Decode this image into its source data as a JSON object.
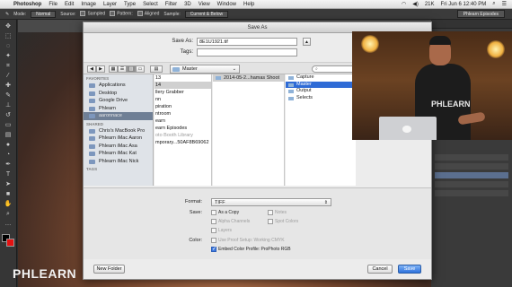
{
  "menubar": {
    "app": "Photoshop",
    "items": [
      "File",
      "Edit",
      "Image",
      "Layer",
      "Type",
      "Select",
      "Filter",
      "3D",
      "View",
      "Window",
      "Help"
    ],
    "battery": "21K",
    "clock": "Fri Jun 6 12:40 PM"
  },
  "options_bar": {
    "mode_label": "Mode:",
    "mode_value": "Normal",
    "source_label": "Source:",
    "sampled_label": "Sampled",
    "pattern_label": "Pattern:",
    "aligned_label": "Aligned",
    "sample_label": "Sample:",
    "sample_value": "Current & Below",
    "workspace": "Phlearn Episodes"
  },
  "dialog": {
    "title": "Save As",
    "save_as_label": "Save As:",
    "save_as_value": "8E1U1921.tif",
    "tags_label": "Tags:",
    "tags_value": "",
    "current_folder": "Master",
    "sidebar": {
      "favorites_heading": "FAVORITES",
      "favorites": [
        "Applications",
        "Desktop",
        "Google Drive",
        "Phlearn",
        "aaronnace"
      ],
      "shared_heading": "SHARED",
      "shared": [
        "Chris's MacBook Pro",
        "Phlearn iMac Aaron",
        "Phlearn iMac Asa",
        "Phlearn iMac Kat",
        "Phlearn iMac Nick"
      ],
      "tags_heading": "TAGS"
    },
    "column1": [
      "13",
      "14",
      "llery Grabber",
      "nn",
      "piration",
      "ntroom",
      "earn",
      "earn Episodes",
      "oto Booth Library",
      "mporary...50AF8B69062"
    ],
    "column2": [
      "2014-05-2...hamas Shoot"
    ],
    "column3": [
      "Capture",
      "Master",
      "Output",
      "Selects"
    ],
    "format_label": "Format:",
    "format_value": "TIFF",
    "save_label": "Save:",
    "save_options": [
      "As a Copy",
      "Notes",
      "Alpha Channels",
      "Spot Colors",
      "Layers"
    ],
    "color_label": "Color:",
    "proof_setup": "Use Proof Setup:  Working CMYK",
    "embed_profile": "Embed Color Profile:  ProPhoto RGB",
    "new_folder": "New Folder",
    "cancel": "Cancel",
    "save": "Save"
  },
  "webcam": {
    "shirt": "PHLEARN"
  },
  "logo": "PHLEARN"
}
